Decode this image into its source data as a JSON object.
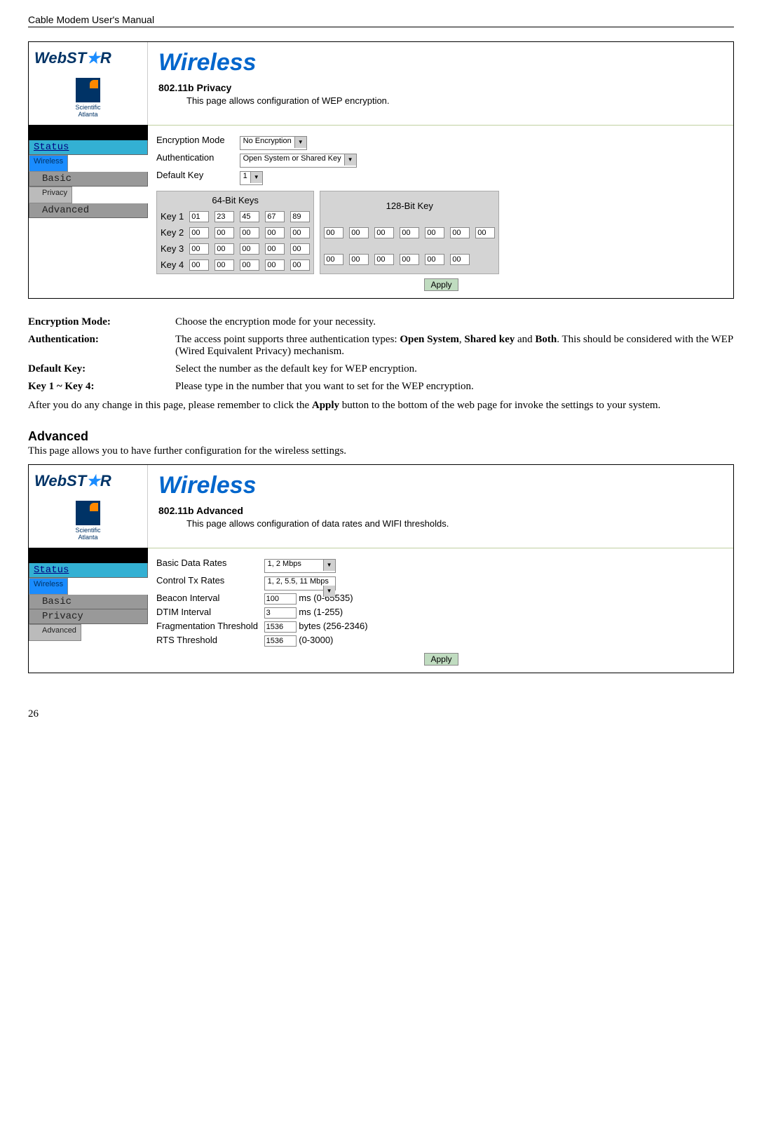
{
  "doc_header": "Cable Modem User's Manual",
  "page_number": "26",
  "screenshot1": {
    "logo": "WebST",
    "logo_star": "★",
    "logo_r": "R",
    "sa1": "Scientific",
    "sa2": "Atlanta",
    "title": "Wireless",
    "subtitle": "802.11b Privacy",
    "desc": "This page allows configuration of WEP encryption.",
    "nav": {
      "status": "Status",
      "wireless": "Wireless",
      "basic": "Basic",
      "privacy": "Privacy",
      "advanced": "Advanced"
    },
    "labels": {
      "encmode": "Encryption Mode",
      "auth": "Authentication",
      "defkey": "Default Key"
    },
    "values": {
      "encmode": "No Encryption",
      "auth": "Open System or Shared Key",
      "defkey": "1"
    },
    "keys64_title": "64-Bit Keys",
    "keys128_title": "128-Bit Key",
    "rowlabels": [
      "Key 1",
      "Key 2",
      "Key 3",
      "Key 4"
    ],
    "keys64": [
      [
        "01",
        "23",
        "45",
        "67",
        "89"
      ],
      [
        "00",
        "00",
        "00",
        "00",
        "00"
      ],
      [
        "00",
        "00",
        "00",
        "00",
        "00"
      ],
      [
        "00",
        "00",
        "00",
        "00",
        "00"
      ]
    ],
    "keys128": [
      [
        "00",
        "00",
        "00",
        "00",
        "00",
        "00",
        "00"
      ],
      [
        "00",
        "00",
        "00",
        "00",
        "00",
        "00",
        ""
      ]
    ],
    "apply": "Apply"
  },
  "defs": {
    "encmode_t": "Encryption Mode:",
    "encmode_d": "Choose the encryption mode for your necessity.",
    "auth_t": "Authentication:",
    "auth_d1": "The access point supports three authentication types: ",
    "auth_b1": "Open System",
    "auth_c1": ", ",
    "auth_b2": "Shared key",
    "auth_c2": " and ",
    "auth_b3": "Both",
    "auth_d2": ". This should be considered with the WEP (Wired Equivalent Privacy) mechanism.",
    "defkey_t": "Default Key:",
    "defkey_d": "Select the number as the default key for WEP encryption.",
    "key14_t": "Key 1 ~ Key 4:",
    "key14_d": "Please type in the number that you want to set for the WEP encryption."
  },
  "note1a": "After you do any change in this page, please remember to click the ",
  "note1b": "Apply",
  "note1c": " button to the bottom of the web page for invoke the settings to your system.",
  "adv_heading": "Advanced",
  "adv_intro": "This page allows you to have further configuration for the wireless settings.",
  "screenshot2": {
    "title": "Wireless",
    "subtitle": "802.11b Advanced",
    "desc": "This page allows configuration of data rates and WIFI thresholds.",
    "nav": {
      "status": "Status",
      "wireless": "Wireless",
      "basic": "Basic",
      "privacy": "Privacy",
      "advanced": "Advanced"
    },
    "rows": {
      "bdr_l": "Basic Data Rates",
      "bdr_v": "1, 2 Mbps",
      "ctr_l": "Control Tx Rates",
      "ctr_v": "1, 2, 5.5, 11 Mbps",
      "bi_l": "Beacon Interval",
      "bi_v": "100",
      "bi_u": "ms (0-65535)",
      "dtim_l": "DTIM Interval",
      "dtim_v": "3",
      "dtim_u": "ms (1-255)",
      "ft_l": "Fragmentation Threshold",
      "ft_v": "1536",
      "ft_u": "bytes (256-2346)",
      "rts_l": "RTS Threshold",
      "rts_v": "1536",
      "rts_u": "(0-3000)"
    },
    "apply": "Apply"
  }
}
